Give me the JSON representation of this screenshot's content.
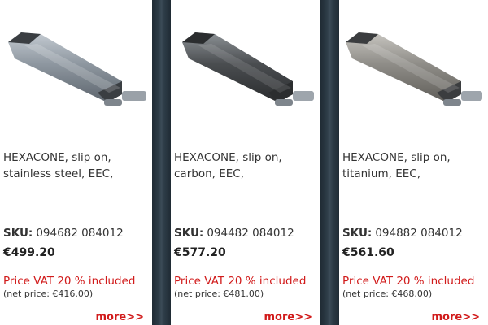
{
  "products": [
    {
      "image_icon": "silencer-stainless-icon",
      "name": "HEXACONE, slip on, stainless steel, EEC,",
      "sku_label": "SKU:",
      "sku_value": "094682 084012",
      "price": "€499.20",
      "vat_text": "Price VAT 20 % included",
      "net_price": "(net price: €416.00)",
      "more_label": "more>>",
      "colors": {
        "body": "#8e97a0",
        "body_light": "#c4cbd2",
        "body_dark": "#5d656d",
        "cap": "#3a3e42"
      }
    },
    {
      "image_icon": "silencer-carbon-icon",
      "name": "HEXACONE, slip on, carbon, EEC,",
      "sku_label": "SKU:",
      "sku_value": "094482 084012",
      "price": "€577.20",
      "vat_text": "Price VAT 20 % included",
      "net_price": "(net price: €481.00)",
      "more_label": "more>>",
      "colors": {
        "body": "#4a4d50",
        "body_light": "#8d9296",
        "body_dark": "#2a2c2e",
        "cap": "#2b2d2f"
      }
    },
    {
      "image_icon": "silencer-titanium-icon",
      "name": "HEXACONE, slip on, titanium, EEC,",
      "sku_label": "SKU:",
      "sku_value": "094882 084012",
      "price": "€561.60",
      "vat_text": "Price VAT 20 % included",
      "net_price": "(net price: €468.00)",
      "more_label": "more>>",
      "colors": {
        "body": "#8f8d88",
        "body_light": "#c8c6c1",
        "body_dark": "#5f5d59",
        "cap": "#3b3d3f"
      }
    }
  ]
}
